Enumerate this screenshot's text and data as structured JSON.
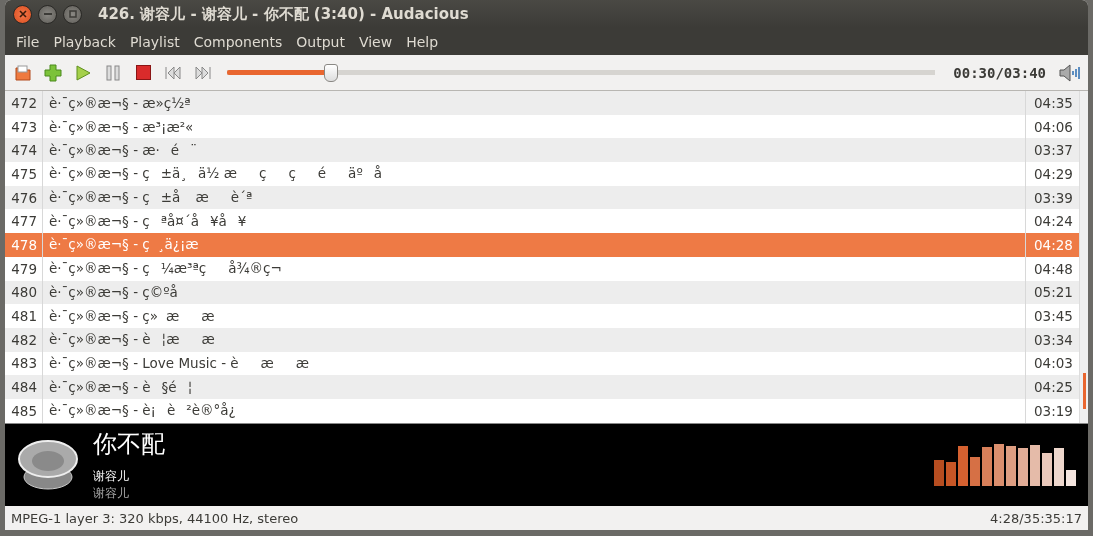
{
  "window": {
    "title": "426. 谢容儿 - 谢容儿 - 你不配 (3:40) - Audacious"
  },
  "menu": [
    "File",
    "Playback",
    "Playlist",
    "Components",
    "Output",
    "View",
    "Help"
  ],
  "toolbar": {
    "buttons": [
      {
        "kind": "open"
      },
      {
        "kind": "add"
      },
      {
        "kind": "play"
      },
      {
        "kind": "pause"
      },
      {
        "kind": "stop"
      },
      {
        "kind": "previous"
      },
      {
        "kind": "next"
      }
    ],
    "seek": {
      "level": 0.145
    },
    "time": "00:30/03:40"
  },
  "playlist": [
    {
      "number": "472",
      "title": "è·¯ç»®æ¬§ - æ»ç½ª",
      "duration": "04:35",
      "selected": false
    },
    {
      "number": "473",
      "title": "è·¯ç»®æ¬§ - æ³¡æ²«",
      "duration": "04:06",
      "selected": false
    },
    {
      "number": "474",
      "title": "è·¯ç»®æ¬§ - æ·é¨",
      "duration": "03:37",
      "selected": false
    },
    {
      "number": "475",
      "title": "è·¯ç»®æ¬§ - ç±ä¸ä½ æççéäºå",
      "duration": "04:29",
      "selected": false
    },
    {
      "number": "476",
      "title": "è·¯ç»®æ¬§ - ç±å æè´ª",
      "duration": "03:39",
      "selected": false
    },
    {
      "number": "477",
      "title": "è·¯ç»®æ¬§ - çªå¤´å¥å¥",
      "duration": "04:24",
      "selected": false
    },
    {
      "number": "478",
      "title": "è·¯ç»®æ¬§ - ç¸ä¿¡æ",
      "duration": "04:28",
      "selected": true
    },
    {
      "number": "479",
      "title": "è·¯ç»®æ¬§ - ç¼æ³ªçå¾®ç¬",
      "duration": "04:48",
      "selected": false
    },
    {
      "number": "480",
      "title": "è·¯ç»®æ¬§ - ç©ºå",
      "duration": "05:21",
      "selected": false
    },
    {
      "number": "481",
      "title": "è·¯ç»®æ¬§ - ç»ææ",
      "duration": "03:45",
      "selected": false
    },
    {
      "number": "482",
      "title": "è·¯ç»®æ¬§ - è¦ææ",
      "duration": "03:34",
      "selected": false
    },
    {
      "number": "483",
      "title": "è·¯ç»®æ¬§ - Love Music - èææ",
      "duration": "04:03",
      "selected": false
    },
    {
      "number": "484",
      "title": "è·¯ç»®æ¬§ - è§é¦",
      "duration": "04:25",
      "selected": false
    },
    {
      "number": "485",
      "title": "è·¯ç»®æ¬§ - è¡è²è®°å¿",
      "duration": "03:19",
      "selected": false
    }
  ],
  "now_playing": {
    "title": "你不配",
    "artist": "谢容儿",
    "album": "谢容儿"
  },
  "status_bar": {
    "format": "MPEG-1 layer 3: 320 kbps, 44100 Hz, stereo",
    "position": "4:28/35:35:17"
  }
}
